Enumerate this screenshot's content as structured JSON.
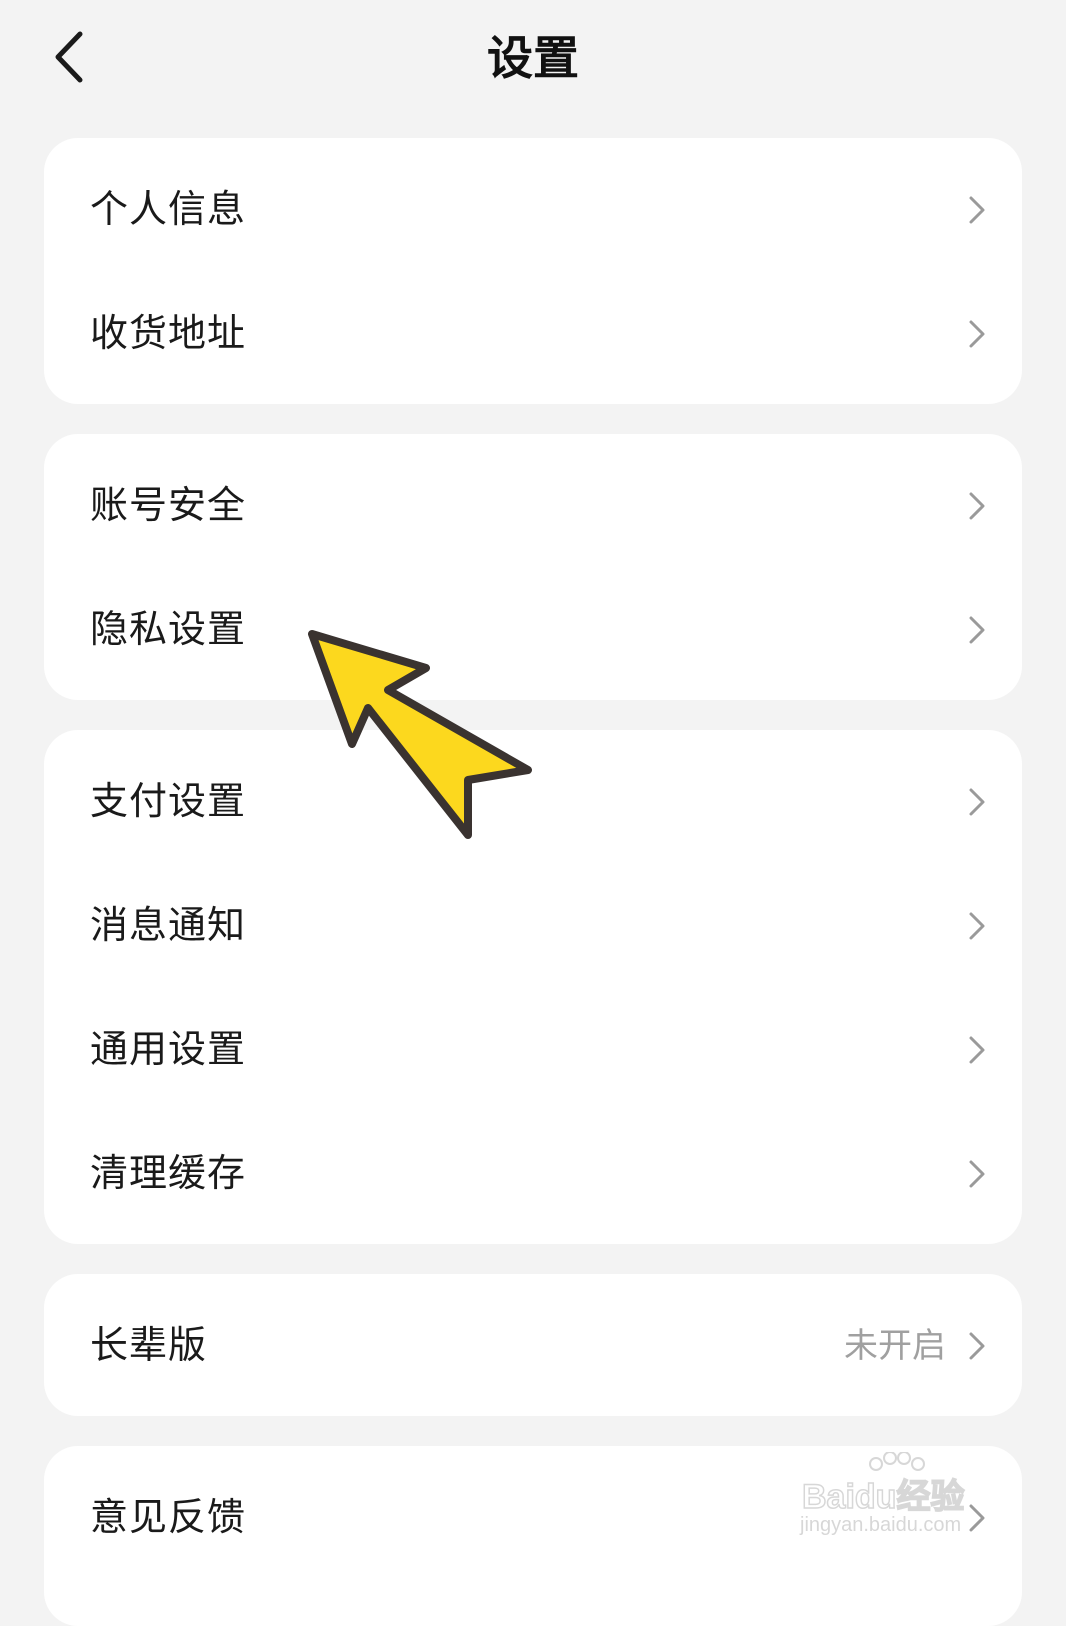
{
  "header": {
    "title": "设置",
    "back_icon": "chevron-left-icon"
  },
  "groups": [
    {
      "items": [
        {
          "label": "个人信息"
        },
        {
          "label": "收货地址"
        }
      ]
    },
    {
      "items": [
        {
          "label": "账号安全"
        },
        {
          "label": "隐私设置"
        }
      ]
    },
    {
      "items": [
        {
          "label": "支付设置"
        },
        {
          "label": "消息通知"
        },
        {
          "label": "通用设置"
        },
        {
          "label": "清理缓存"
        }
      ]
    },
    {
      "items": [
        {
          "label": "长辈版",
          "value": "未开启"
        }
      ]
    },
    {
      "items": [
        {
          "label": "意见反馈"
        }
      ]
    }
  ],
  "annotation": {
    "icon": "yellow-pointer-arrow-icon",
    "fill_color": "#fcd81e",
    "stroke_color": "#3a3330"
  },
  "watermark": {
    "text_main": "Baidu经验",
    "text_url": "jingyan.baidu.com"
  },
  "colors": {
    "background": "#f3f3f3",
    "card": "#ffffff",
    "text": "#1a1a1a",
    "secondary_text": "#a0a0a0",
    "chevron": "#9a9a9a"
  }
}
